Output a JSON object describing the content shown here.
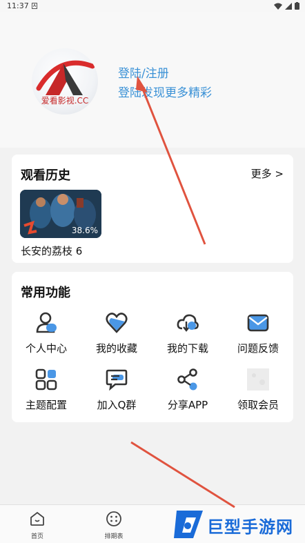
{
  "status_bar": {
    "time": "11:37",
    "notification_glyph": "A"
  },
  "header": {
    "avatar_text": "爱看影视.CC",
    "login_title": "登陆/注册",
    "login_subtitle": "登陆发现更多精彩"
  },
  "history": {
    "title": "观看历史",
    "more_label": "更多 >",
    "items": [
      {
        "title": "长安的荔枝 6",
        "progress": "38.6%"
      }
    ]
  },
  "functions": {
    "title": "常用功能",
    "items": [
      {
        "label": "个人中心",
        "icon": "user-icon"
      },
      {
        "label": "我的收藏",
        "icon": "heart-icon"
      },
      {
        "label": "我的下载",
        "icon": "cloud-download-icon"
      },
      {
        "label": "问题反馈",
        "icon": "mail-icon"
      },
      {
        "label": "主题配置",
        "icon": "grid-icon"
      },
      {
        "label": "加入Q群",
        "icon": "chat-icon"
      },
      {
        "label": "分享APP",
        "icon": "share-icon"
      },
      {
        "label": "领取会员",
        "icon": "placeholder-icon"
      }
    ]
  },
  "bottom_nav": {
    "items": [
      {
        "label": "首页",
        "icon": "home-icon"
      },
      {
        "label": "排期表",
        "icon": "schedule-icon"
      }
    ]
  },
  "watermark": {
    "text": "巨型手游网"
  },
  "colors": {
    "accent": "#3a91d6",
    "icon_blue": "#4a97e6",
    "icon_dark": "#333333",
    "arrow_red": "#e0533f"
  }
}
